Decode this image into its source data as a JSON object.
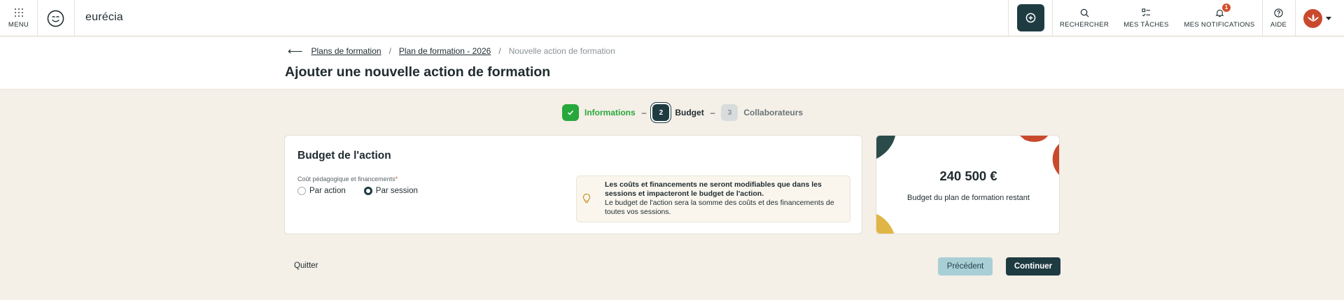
{
  "topbar": {
    "menu_label": "MENU",
    "brand": "eurécia",
    "nav": [
      {
        "label": "RECHERCHER",
        "icon": "search-icon"
      },
      {
        "label": "MES TÂCHES",
        "icon": "tasks-icon"
      },
      {
        "label": "MES NOTIFICATIONS",
        "icon": "bell-icon",
        "badge": "1"
      },
      {
        "label": "AIDE",
        "icon": "help-icon"
      }
    ],
    "create_icon": "plus-circle-icon",
    "accent": "#1f3b42",
    "badge_color": "#d2512f"
  },
  "breadcrumb": {
    "items": [
      "Plans de formation",
      "Plan de formation - 2026"
    ],
    "current": "Nouvelle action de formation"
  },
  "page_title": "Ajouter une nouvelle action de formation",
  "stepper": {
    "steps": [
      {
        "number": "1",
        "label": "Informations",
        "state": "done"
      },
      {
        "number": "2",
        "label": "Budget",
        "state": "active"
      },
      {
        "number": "3",
        "label": "Collaborateurs",
        "state": "todo"
      }
    ],
    "done_color": "#27a83c"
  },
  "budget_card": {
    "title": "Budget de l'action",
    "field_label": "Coût pédagogique et financements",
    "required_mark": "*",
    "options": [
      {
        "label": "Par action",
        "selected": false
      },
      {
        "label": "Par session",
        "selected": true
      }
    ],
    "info_bold": "Les coûts et financements ne seront modifiables que dans les sessions et impacteront le budget de l'action.",
    "info_text": "Le budget de l'action sera la somme des coûts et des financements de toutes vos sessions."
  },
  "remaining": {
    "amount": "240 500 €",
    "label": "Budget du plan de formation restant"
  },
  "footer": {
    "quit": "Quitter",
    "previous": "Précédent",
    "continue": "Continuer"
  }
}
